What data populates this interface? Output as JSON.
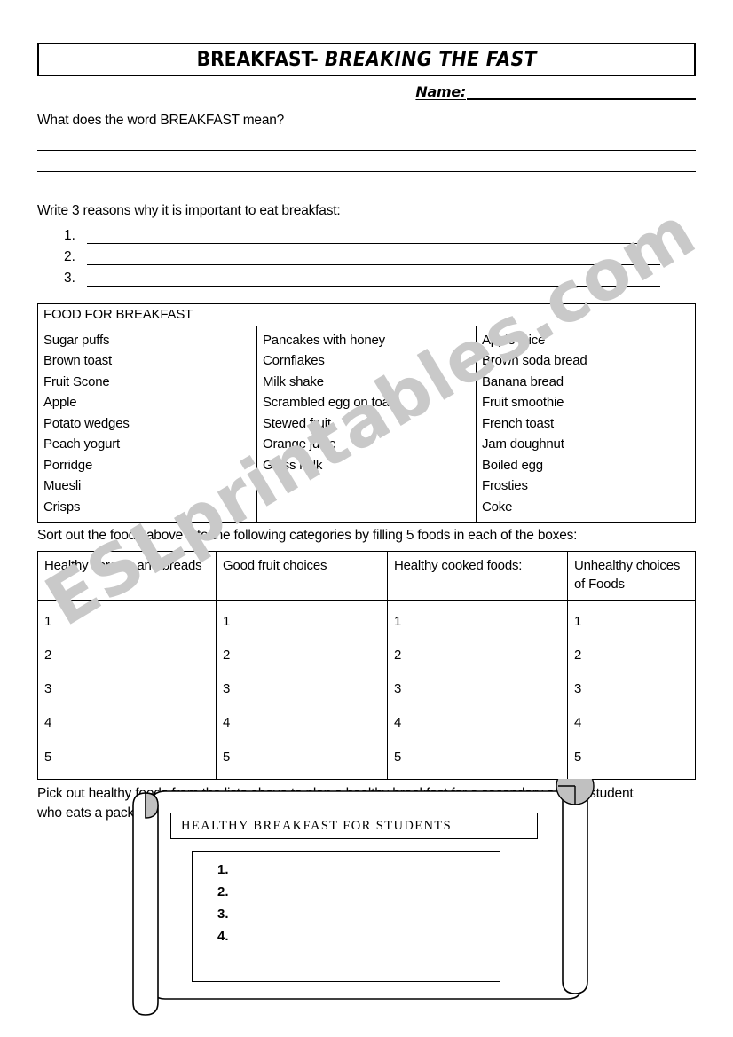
{
  "header": {
    "title_main": "BREAKFAST-",
    "title_em": "BREAKING THE FAST",
    "name_label": "Name:"
  },
  "question1": {
    "prompt": "What does the word BREAKFAST mean?"
  },
  "question2": {
    "prompt": "Write 3 reasons why it is important to eat breakfast:",
    "numbers": [
      "1.",
      "2.",
      "3."
    ]
  },
  "food_table": {
    "heading": "FOOD FOR BREAKFAST",
    "column1": [
      "Sugar puffs",
      "Brown toast",
      "Fruit Scone",
      "Apple",
      "Potato wedges",
      "Peach yogurt",
      "Porridge",
      "Muesli",
      "Crisps"
    ],
    "column2": [
      "Pancakes with honey",
      "Cornflakes",
      "Milk shake",
      "Scrambled egg on toast",
      "Stewed fruit",
      "Orange juice",
      "Glass milk"
    ],
    "column3": [
      "Apple juice",
      "Brown soda bread",
      "Banana bread",
      "Fruit smoothie",
      "French toast",
      "Jam doughnut",
      "Boiled egg",
      "Frosties",
      "Coke"
    ]
  },
  "question3": {
    "prompt": "Sort out the foods above into the following categories by filling 5 foods in each of the boxes:"
  },
  "sort_table": {
    "headers": [
      "Healthy cereals and breads",
      "Good fruit choices",
      "Healthy cooked foods:",
      "Unhealthy choices of Foods"
    ],
    "rows": [
      "1",
      "2",
      "3",
      "4",
      "5"
    ]
  },
  "question4": {
    "prompt": "Pick out healthy foods from the lists above to plan a healthy breakfast for a secondary school student who eats a packed lunch everyday."
  },
  "scroll": {
    "title": "HEALTHY BREAKFAST FOR STUDENTS",
    "items": [
      "1.",
      "2.",
      "3.",
      "4."
    ],
    "roll_fill": "#c0c0c0"
  },
  "watermark": {
    "text": "ESLprintables.com",
    "color": "#c9c9c9"
  }
}
